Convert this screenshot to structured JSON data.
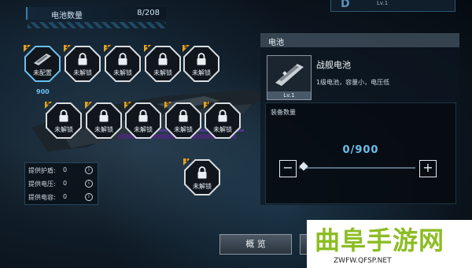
{
  "topbar": {
    "title": "电池数量",
    "count": "8/208"
  },
  "toptab": {
    "level": "Lv.1",
    "glyph": "D"
  },
  "slots": [
    {
      "label": "未配置",
      "tag": "1",
      "state": "selected",
      "qty": "900"
    },
    {
      "label": "未解锁",
      "tag": "2",
      "state": "locked"
    },
    {
      "label": "未解锁",
      "tag": "3",
      "state": "locked"
    },
    {
      "label": "未解锁",
      "tag": "4",
      "state": "locked"
    },
    {
      "label": "未解锁",
      "tag": "5",
      "state": "locked"
    },
    {
      "label": "未解锁",
      "tag": "6",
      "state": "locked"
    },
    {
      "label": "未解锁",
      "tag": "7",
      "state": "locked"
    },
    {
      "label": "未解锁",
      "tag": "8",
      "state": "locked"
    },
    {
      "label": "未解锁",
      "tag": "9",
      "state": "locked"
    },
    {
      "label": "未解锁",
      "tag": "10",
      "state": "locked"
    },
    {
      "label": "未解锁",
      "tag": "11",
      "state": "locked"
    }
  ],
  "stats": [
    {
      "label": "提供护盾:",
      "value": "0"
    },
    {
      "label": "提供电压:",
      "value": "0"
    },
    {
      "label": "提供电容:",
      "value": "0"
    }
  ],
  "panel": {
    "title": "电池",
    "item_name": "战舰电池",
    "item_desc": "1级电池，容量小，电压低",
    "item_level": "Lv.1",
    "equip_title": "装备数量",
    "quantity": "0/900",
    "slider_fraction": 0
  },
  "buttons": {
    "overview": "概 览"
  },
  "watermark": {
    "big": "曲阜手游网",
    "small": "ZWFW.QFSP.NET"
  },
  "colors": {
    "accent": "#6ac1ee",
    "tag": "#e3a31e",
    "watermark_green": "#8cbd24"
  }
}
